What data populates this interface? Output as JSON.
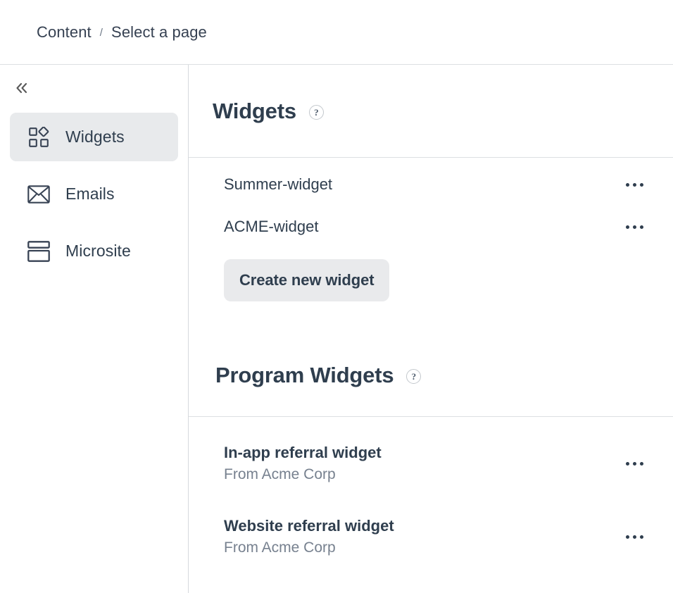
{
  "breadcrumb": {
    "root": "Content",
    "separator": "/",
    "current": "Select a page"
  },
  "sidebar": {
    "collapse_label": "«",
    "items": [
      {
        "label": "Widgets",
        "icon": "widgets-icon",
        "active": true
      },
      {
        "label": "Emails",
        "icon": "envelope-icon",
        "active": false
      },
      {
        "label": "Microsite",
        "icon": "microsite-icon",
        "active": false
      }
    ]
  },
  "main": {
    "widgets_section": {
      "title": "Widgets",
      "help_glyph": "?",
      "items": [
        {
          "title": "Summer-widget",
          "menu": "more-options"
        },
        {
          "title": "ACME-widget",
          "menu": "more-options"
        }
      ],
      "create_button": "Create new widget"
    },
    "program_section": {
      "title": "Program Widgets",
      "help_glyph": "?",
      "items": [
        {
          "title": "In-app referral widget",
          "subtitle": "From Acme Corp",
          "menu": "more-options"
        },
        {
          "title": "Website referral widget",
          "subtitle": "From Acme Corp",
          "menu": "more-options"
        }
      ]
    }
  },
  "colors": {
    "text": "#2f3e4e",
    "muted": "#77818f",
    "active_bg": "#e8eaec",
    "button_bg": "#e9eaec",
    "divider": "#dcdfe2"
  }
}
